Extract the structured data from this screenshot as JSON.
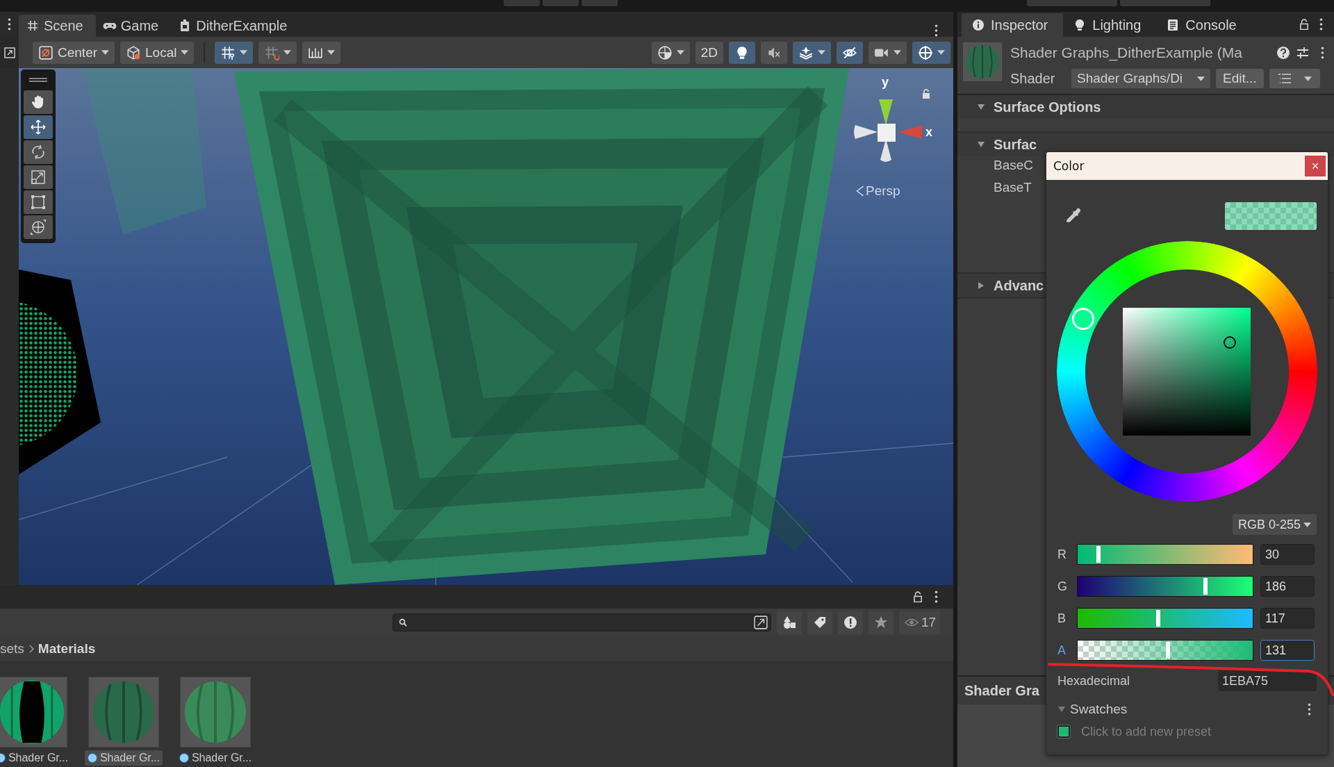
{
  "scene_tabs": [
    {
      "kind": "scene",
      "label": "Scene",
      "selected": true
    },
    {
      "kind": "game",
      "label": "Game",
      "selected": false
    },
    {
      "kind": "prefab",
      "label": "DitherExample",
      "selected": false
    }
  ],
  "scene_toolbar": {
    "left": [
      {
        "kind": "pivot",
        "label": "Center",
        "on": false,
        "menu": true
      },
      {
        "kind": "space",
        "label": "Local",
        "on": false,
        "menu": true
      },
      {
        "kind": "grid",
        "on": true,
        "menu": true
      },
      {
        "kind": "snap",
        "on": false,
        "menu": true
      },
      {
        "kind": "increment",
        "on": false,
        "menu": true
      }
    ],
    "right": [
      {
        "kind": "shading",
        "on": false,
        "menu": true
      },
      {
        "kind": "mode",
        "label": "2D",
        "on": false,
        "menu": false
      },
      {
        "kind": "lighting",
        "on": true,
        "menu": false
      },
      {
        "kind": "audio",
        "on": false,
        "menu": false
      },
      {
        "kind": "effects",
        "on": true,
        "menu": true
      },
      {
        "kind": "visibility",
        "on": true,
        "menu": false
      },
      {
        "kind": "camera",
        "on": false,
        "menu": true
      },
      {
        "kind": "gizmos",
        "on": true,
        "menu": true
      }
    ]
  },
  "tools": [
    {
      "kind": "hand",
      "selected": false
    },
    {
      "kind": "move",
      "selected": true
    },
    {
      "kind": "rotate",
      "selected": false
    },
    {
      "kind": "scale",
      "selected": false
    },
    {
      "kind": "rect",
      "selected": false
    },
    {
      "kind": "transform",
      "selected": false
    }
  ],
  "gizmo": {
    "y_label": "y",
    "x_label": "x",
    "projection": "Persp"
  },
  "inspector_tabs": [
    {
      "kind": "info",
      "label": "Inspector",
      "selected": true
    },
    {
      "kind": "lighting",
      "label": "Lighting",
      "selected": false
    },
    {
      "kind": "console",
      "label": "Console",
      "selected": false
    }
  ],
  "material": {
    "title": "Shader Graphs_DitherExample (Ma",
    "shader_label": "Shader",
    "shader": "Shader Graphs/Di",
    "edit": "Edit..."
  },
  "sections": [
    {
      "label": "Surface Options",
      "expanded": true
    },
    {
      "label": "Surfac",
      "expanded": true,
      "properties": [
        "BaseC",
        "BaseT"
      ]
    },
    {
      "label": "Advanc",
      "expanded": false
    }
  ],
  "preview_header": "Shader Gra",
  "color_picker": {
    "title": "Color",
    "close": "×",
    "mode": "RGB 0-255",
    "channels": [
      {
        "name": "R",
        "level": 0.118,
        "value": "30",
        "focused": false
      },
      {
        "name": "G",
        "level": 0.729,
        "value": "186",
        "focused": false
      },
      {
        "name": "B",
        "level": 0.459,
        "value": "117",
        "focused": false
      },
      {
        "name": "A",
        "level": 0.514,
        "value": "131",
        "focused": true
      }
    ],
    "hex_label": "Hexadecimal",
    "hex_value": "1EBA75",
    "swatches_label": "Swatches",
    "swatches_expanded": true,
    "preset_hint": "Click to add new preset"
  },
  "project": {
    "count": "17",
    "breadcrumb": [
      "sets",
      "Materials"
    ],
    "assets": [
      {
        "label": "Shader Gr...",
        "selected": false
      },
      {
        "label": "Shader Gr...",
        "selected": true
      },
      {
        "label": "Shader Gr...",
        "selected": false
      }
    ]
  }
}
